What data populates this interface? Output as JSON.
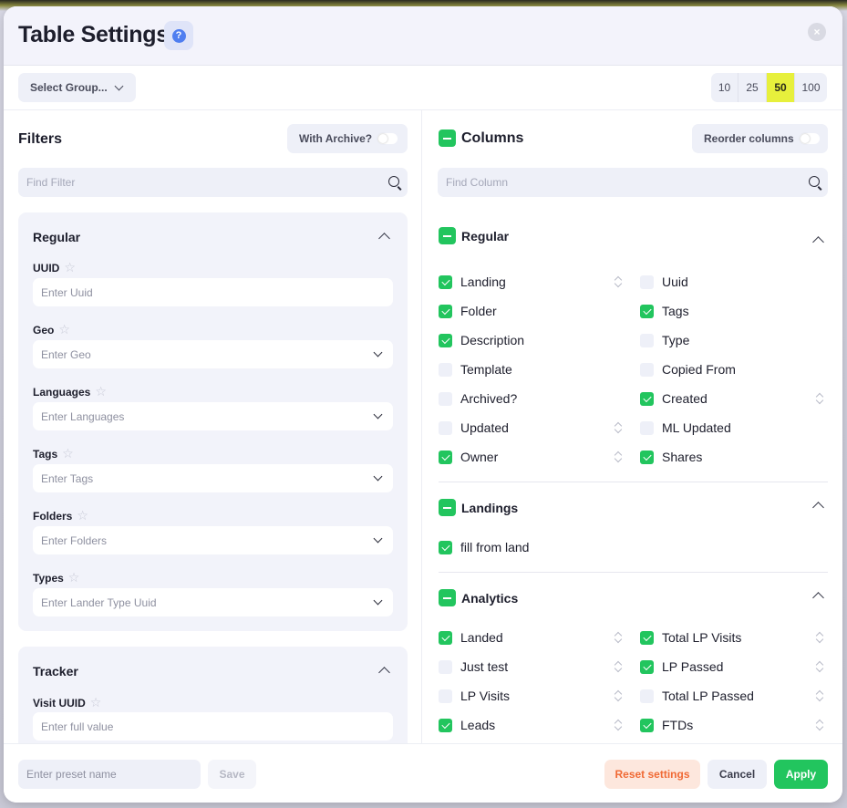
{
  "header": {
    "title": "Table Settings",
    "help_icon": "?",
    "close_icon": "×"
  },
  "toolbar": {
    "group_select": "Select Group...",
    "page_sizes": [
      "10",
      "25",
      "50",
      "100"
    ],
    "active_page_size": "50"
  },
  "filters": {
    "title": "Filters",
    "archive_toggle": "With Archive?",
    "search_placeholder": "Find Filter",
    "regular": {
      "title": "Regular",
      "fields": [
        {
          "label": "UUID",
          "placeholder": "Enter Uuid",
          "dropdown": false
        },
        {
          "label": "Geo",
          "placeholder": "Enter Geo",
          "dropdown": true
        },
        {
          "label": "Languages",
          "placeholder": "Enter Languages",
          "dropdown": true
        },
        {
          "label": "Tags",
          "placeholder": "Enter Tags",
          "dropdown": true
        },
        {
          "label": "Folders",
          "placeholder": "Enter Folders",
          "dropdown": true
        },
        {
          "label": "Types",
          "placeholder": "Enter Lander Type Uuid",
          "dropdown": true
        }
      ]
    },
    "tracker": {
      "title": "Tracker",
      "fields": [
        {
          "label": "Visit UUID",
          "placeholder": "Enter full value",
          "dropdown": false
        }
      ]
    }
  },
  "columns": {
    "title": "Columns",
    "reorder_toggle": "Reorder columns",
    "search_placeholder": "Find Column",
    "groups": [
      {
        "title": "Regular",
        "items": [
          {
            "label": "Landing",
            "checked": true,
            "sortable": true
          },
          {
            "label": "Uuid",
            "checked": false,
            "sortable": false
          },
          {
            "label": "Folder",
            "checked": true,
            "sortable": false
          },
          {
            "label": "Tags",
            "checked": true,
            "sortable": false
          },
          {
            "label": "Description",
            "checked": true,
            "sortable": false
          },
          {
            "label": "Type",
            "checked": false,
            "sortable": false
          },
          {
            "label": "Template",
            "checked": false,
            "sortable": false
          },
          {
            "label": "Copied From",
            "checked": false,
            "sortable": false
          },
          {
            "label": "Archived?",
            "checked": false,
            "sortable": false
          },
          {
            "label": "Created",
            "checked": true,
            "sortable": true
          },
          {
            "label": "Updated",
            "checked": false,
            "sortable": true
          },
          {
            "label": "ML Updated",
            "checked": false,
            "sortable": false
          },
          {
            "label": "Owner",
            "checked": true,
            "sortable": true
          },
          {
            "label": "Shares",
            "checked": true,
            "sortable": false
          }
        ]
      },
      {
        "title": "Landings",
        "items": [
          {
            "label": "fill from land",
            "checked": true,
            "sortable": false
          }
        ]
      },
      {
        "title": "Analytics",
        "items": [
          {
            "label": "Landed",
            "checked": true,
            "sortable": true
          },
          {
            "label": "Total LP Visits",
            "checked": true,
            "sortable": true
          },
          {
            "label": "Just test",
            "checked": false,
            "sortable": true
          },
          {
            "label": "LP Passed",
            "checked": true,
            "sortable": true
          },
          {
            "label": "LP Visits",
            "checked": false,
            "sortable": true
          },
          {
            "label": "Total LP Passed",
            "checked": false,
            "sortable": true
          },
          {
            "label": "Leads",
            "checked": true,
            "sortable": true
          },
          {
            "label": "FTDs",
            "checked": true,
            "sortable": true
          }
        ]
      }
    ]
  },
  "footer": {
    "preset_placeholder": "Enter preset name",
    "save": "Save",
    "reset": "Reset settings",
    "cancel": "Cancel",
    "apply": "Apply"
  },
  "colors": {
    "accent_green": "#22c55e",
    "active_yellow": "#e7f03c",
    "reset_orange": "#f06a35",
    "help_blue": "#4f7ef0"
  }
}
